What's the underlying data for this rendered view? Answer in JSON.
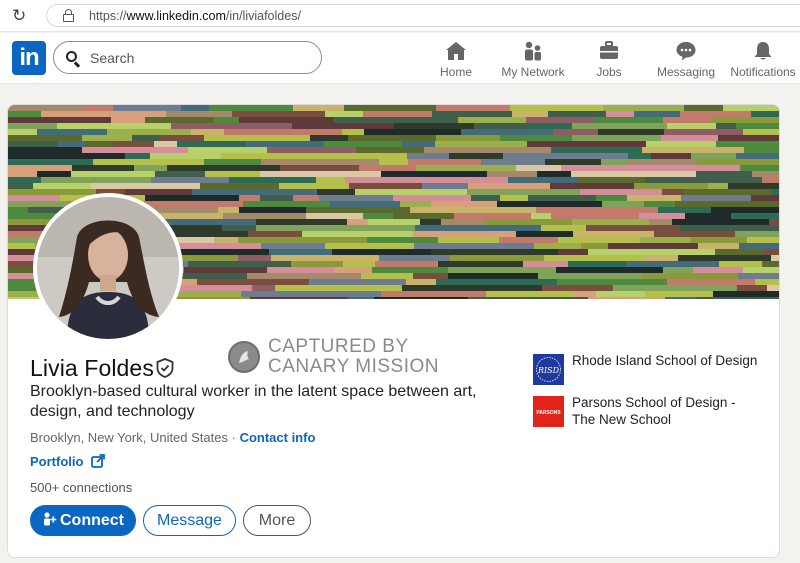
{
  "browser": {
    "url_prefix": "https://",
    "url_host": "www.linkedin.com",
    "url_path": "/in/liviafoldes/"
  },
  "nav": {
    "logo_text": "in",
    "search_placeholder": "Search",
    "items": [
      {
        "label": "Home",
        "icon": "home-icon"
      },
      {
        "label": "My Network",
        "icon": "network-icon"
      },
      {
        "label": "Jobs",
        "icon": "briefcase-icon"
      },
      {
        "label": "Messaging",
        "icon": "chat-icon"
      },
      {
        "label": "Notifications",
        "icon": "bell-icon"
      }
    ]
  },
  "profile": {
    "name": "Livia Foldes",
    "headline": "Brooklyn-based cultural worker in the latent space between art, design, and technology",
    "location": "Brooklyn, New York, United States",
    "separator": " · ",
    "contact_info": "Contact info",
    "portfolio": "Portfolio",
    "connections": "500+ connections",
    "buttons": {
      "connect": "Connect",
      "message": "Message",
      "more": "More"
    }
  },
  "watermark": {
    "line1": "CAPTURED BY",
    "line2": "CANARY MISSION"
  },
  "education": [
    {
      "name": "Rhode Island School of Design",
      "logo_text": "RISD",
      "logo_color": "#1e3a9e"
    },
    {
      "name": "Parsons School of Design - The New School",
      "logo_text": "PARSONS",
      "logo_color": "#e2231a"
    }
  ],
  "colors": {
    "brand": "#0a66c2",
    "background": "#f3f2ef"
  }
}
